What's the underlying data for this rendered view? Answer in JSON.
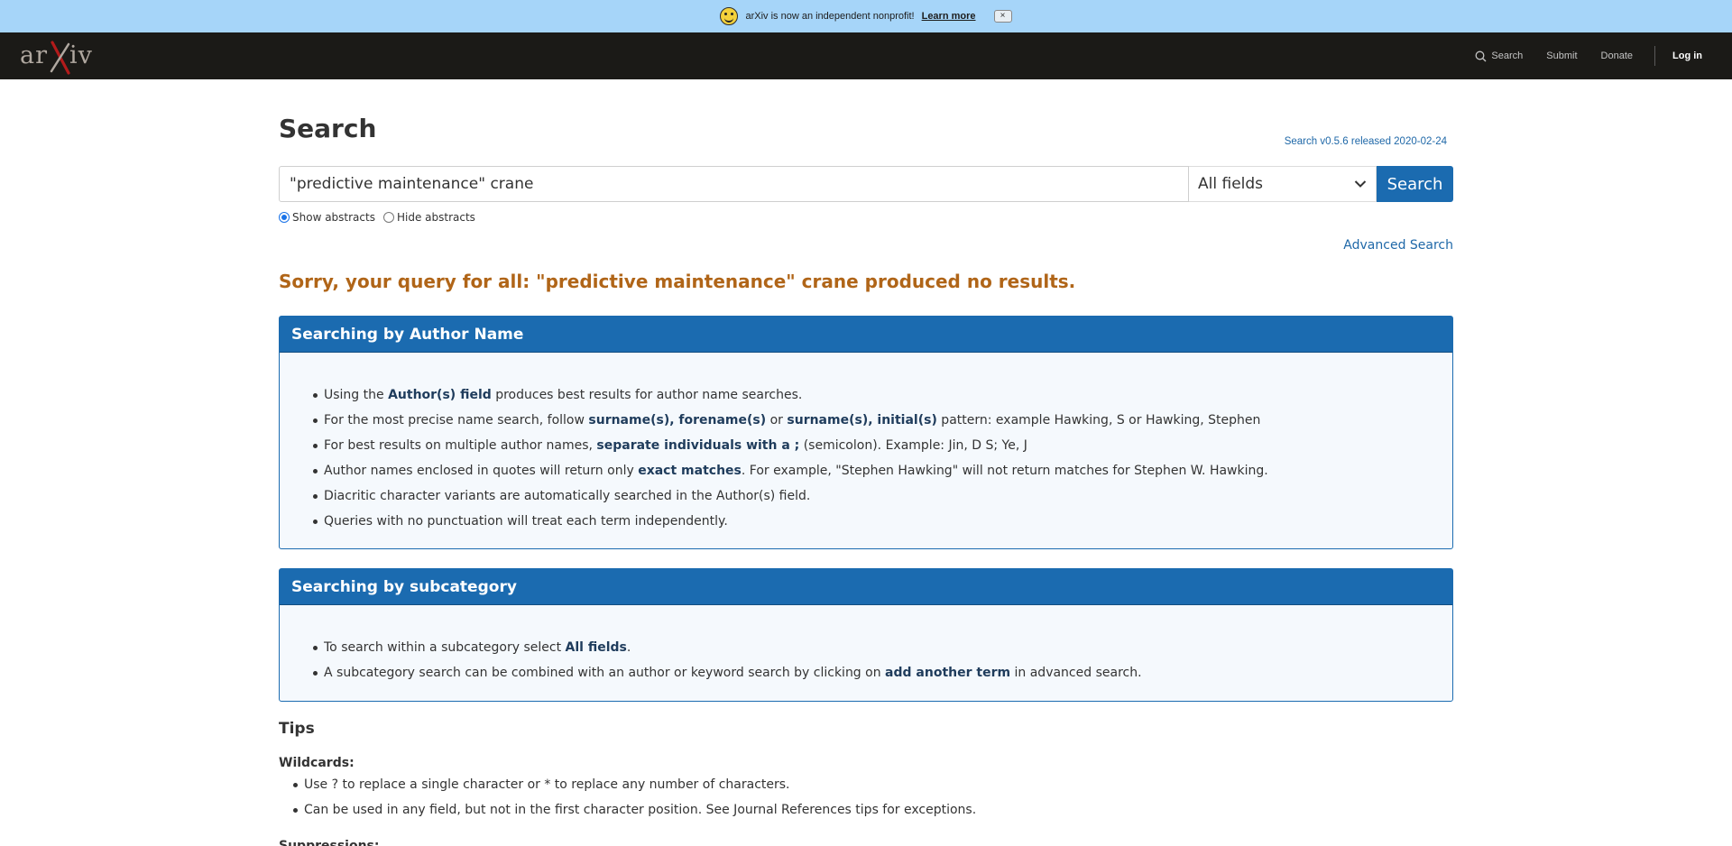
{
  "banner": {
    "icon": "smiley-icon",
    "message": "arXiv is now an independent nonprofit!",
    "learn_more": "Learn more",
    "close": "×"
  },
  "header": {
    "logo": "arXiv",
    "nav": {
      "search": "Search",
      "submit": "Submit",
      "donate": "Donate",
      "login": "Log in"
    }
  },
  "main": {
    "title": "Search",
    "version": "Search v0.5.6 released 2020-02-24",
    "query": "\"predictive maintenance\" crane",
    "field": "All fields",
    "search_button": "Search",
    "show_abstracts": "Show abstracts",
    "hide_abstracts": "Hide abstracts",
    "advanced_search": "Advanced Search",
    "no_results": "Sorry, your query for all: \"predictive maintenance\" crane produced no results."
  },
  "author_panel": {
    "title": "Searching by Author Name",
    "items": [
      {
        "pre": "Using the ",
        "b1": "Author(s) field",
        "mid": " produces best results for author name searches.",
        "b2": "",
        "post": ""
      },
      {
        "pre": "For the most precise name search, follow ",
        "b1": "surname(s), forename(s)",
        "mid": " or ",
        "b2": "surname(s), initial(s)",
        "post": " pattern: example Hawking, S or Hawking, Stephen"
      },
      {
        "pre": "For best results on multiple author names, ",
        "b1": "separate individuals with a ;",
        "mid": " (semicolon). Example: Jin, D S; Ye, J",
        "b2": "",
        "post": ""
      },
      {
        "pre": "Author names enclosed in quotes will return only ",
        "b1": "exact matches",
        "mid": ". For example, \"Stephen Hawking\" will not return matches for Stephen W. Hawking.",
        "b2": "",
        "post": ""
      },
      {
        "pre": "Diacritic character variants are automatically searched in the Author(s) field.",
        "b1": "",
        "mid": "",
        "b2": "",
        "post": ""
      },
      {
        "pre": "Queries with no punctuation will treat each term independently.",
        "b1": "",
        "mid": "",
        "b2": "",
        "post": ""
      }
    ]
  },
  "subcat_panel": {
    "title": "Searching by subcategory",
    "items": [
      {
        "pre": "To search within a subcategory select ",
        "b1": "All fields",
        "mid": ".",
        "b2": "",
        "post": ""
      },
      {
        "pre": "A subcategory search can be combined with an author or keyword search by clicking on ",
        "b1": "add another term",
        "mid": " in advanced search.",
        "b2": "",
        "post": ""
      }
    ]
  },
  "tips": {
    "title": "Tips",
    "wildcards_title": "Wildcards:",
    "wildcards": [
      "Use ? to replace a single character or * to replace any number of characters.",
      "Can be used in any field, but not in the first character position. See Journal References tips for exceptions."
    ],
    "suppressions_title": "Suppressions:"
  }
}
